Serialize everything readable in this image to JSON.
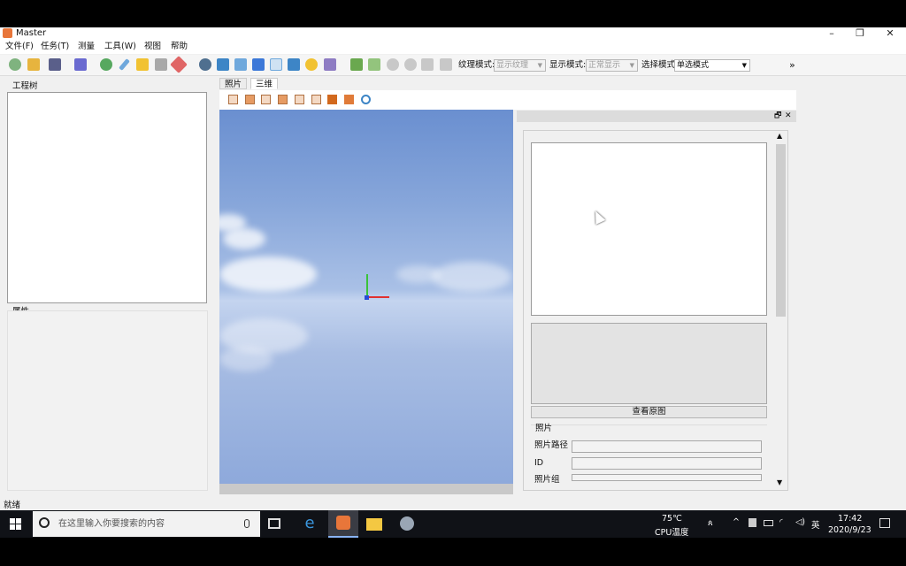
{
  "window": {
    "title": "Master",
    "controls": {
      "minimize": "–",
      "maximize": "❐",
      "close": "✕"
    }
  },
  "menu": [
    "文件(F)",
    "任务(T)",
    "测量",
    "工具(W)",
    "视图",
    "帮助"
  ],
  "toolbar": {
    "texture_label": "纹理模式:",
    "texture_value": "显示纹理",
    "display_label": "显示模式:",
    "display_value": "正常显示",
    "select_label": "选择模式",
    "select_value": "单选模式",
    "more": "»"
  },
  "left": {
    "tree_title": "工程树",
    "props_title": "属性"
  },
  "tabs": [
    {
      "label": "照片",
      "active": false
    },
    {
      "label": "三维",
      "active": true
    }
  ],
  "dock": {
    "float_icon": "🗗",
    "close_icon": "✕",
    "view_original_button": "查看原图",
    "photo_group_title": "照片",
    "fields": [
      {
        "label": "照片路径",
        "value": ""
      },
      {
        "label": "ID",
        "value": ""
      },
      {
        "label": "照片组",
        "value": ""
      }
    ]
  },
  "status": "就绪",
  "taskbar": {
    "search_placeholder": "在这里输入你要搜索的内容",
    "temp": "75℃",
    "temp_label": "CPU温度",
    "ime": "英",
    "time": "17:42",
    "date": "2020/9/23"
  },
  "colors": {
    "taskbar": "#101217",
    "app_icon": "#e8763a",
    "sky_top": "#6a8fd0",
    "horizon": "#c4d4ef"
  }
}
